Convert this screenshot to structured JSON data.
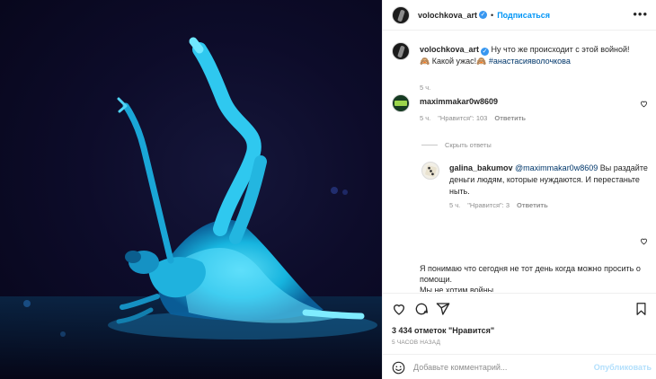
{
  "post": {
    "author": {
      "username": "volochkova_art",
      "verified": true,
      "follow_label": "Подписаться",
      "more_icon": "more-horizontal-icon"
    },
    "caption": {
      "username": "volochkova_art",
      "text": "Ну что же происходит с этой войной!🙈 Какой ужас!🙈",
      "hashtag": "#анастасияволочкова",
      "time": "5 ч."
    },
    "comments": [
      {
        "username": "maximmakar0w8609",
        "text": "",
        "time": "5 ч.",
        "likes": "\"Нравится\": 103",
        "reply_label": "Ответить"
      }
    ],
    "hide_replies_label": "Скрыть ответы",
    "replies": [
      {
        "username": "galina_bakumov",
        "mention": "@maximmakar0w8609",
        "text": "Вы раздайте деньги людям, которые нуждаются. И перестаньте ныть.",
        "time": "5 ч.",
        "likes": "\"Нравится\": 3",
        "reply_label": "Ответить"
      }
    ],
    "next_comment": {
      "text_line1": "Я понимаю что сегодня не тот день когда можно просить о помощи.",
      "text_line2": "Мы не хотим войны."
    },
    "likes_text": "3 434 отметок \"Нравится\"",
    "timestamp": "5 ЧАСОВ НАЗАД",
    "comment_input": {
      "placeholder": "Добавьте комментарий...",
      "publish_label": "Опубликовать"
    },
    "colors": {
      "accent": "#0095f6",
      "publish_disabled": "#b2dffc",
      "muted": "#8e8e8e",
      "media_glow": "#19d4ff"
    },
    "icons": [
      "heart-icon",
      "comment-icon",
      "share-icon",
      "bookmark-icon",
      "emoji-icon"
    ]
  }
}
